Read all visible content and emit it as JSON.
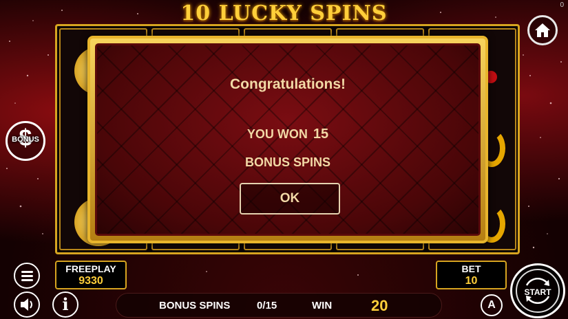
{
  "game": {
    "title": "10 LUCKY SPINS",
    "corner_counter": "0"
  },
  "popup": {
    "heading": "Congratulations!",
    "won_label": "YOU WON",
    "won_amount": "15",
    "won_suffix": "BONUS SPINS",
    "ok_label": "OK"
  },
  "side": {
    "bonus_label": "BONUS",
    "bonus_symbol": "$"
  },
  "panels": {
    "freeplay_label": "FREEPLAY",
    "freeplay_value": "9330",
    "bet_label": "BET",
    "bet_value": "10"
  },
  "bottom_bar": {
    "bonus_spins_label": "BONUS SPINS",
    "bonus_spins_value": "0/15",
    "win_label": "WIN",
    "win_value": "20"
  },
  "controls": {
    "start_label": "START",
    "info_label": "i",
    "auto_label": "A"
  },
  "icons": [
    "home-icon",
    "menu-icon",
    "sound-icon",
    "info-icon",
    "autoplay-icon",
    "start-spin-icon",
    "bonus-dollar-icon"
  ],
  "colors": {
    "gold": "#d7a520",
    "title_gold": "#ffcf3a",
    "popup_text": "#f2d9a6",
    "background": "#1a0203"
  }
}
